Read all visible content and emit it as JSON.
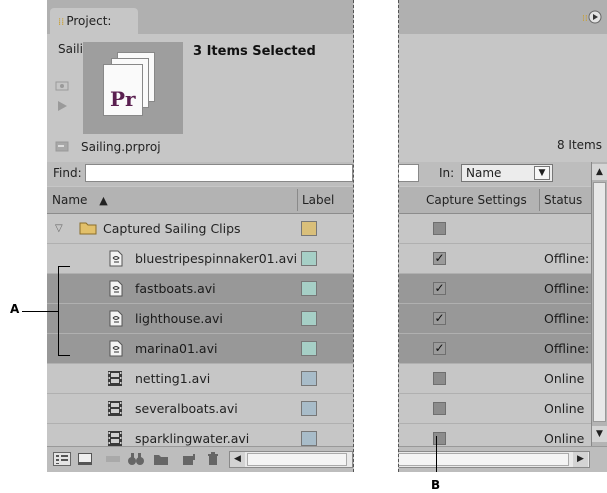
{
  "left_panel": {
    "tab_title": "Project: Sailing",
    "tab_close": "×",
    "selected_title": "3 Items Selected",
    "thumbnail_text": "Pr",
    "project_file": "Sailing.prproj",
    "find_label": "Find:",
    "columns": {
      "name": "Name",
      "label": "Label"
    },
    "rows": [
      {
        "name": "Captured Sailing Clips",
        "kind": "folder",
        "label_color": "#d9bf7a",
        "selected": false
      },
      {
        "name": "bluestripespinnaker01.avi",
        "kind": "file",
        "label_color": "#a6cfc6",
        "selected": false
      },
      {
        "name": "fastboats.avi",
        "kind": "file",
        "label_color": "#a6cfc6",
        "selected": true
      },
      {
        "name": "lighthouse.avi",
        "kind": "file",
        "label_color": "#a6cfc6",
        "selected": true
      },
      {
        "name": "marina01.avi",
        "kind": "file",
        "label_color": "#a6cfc6",
        "selected": true
      },
      {
        "name": "netting1.avi",
        "kind": "film",
        "label_color": "#a8bcc9",
        "selected": false
      },
      {
        "name": "severalboats.avi",
        "kind": "film",
        "label_color": "#a8bcc9",
        "selected": false
      },
      {
        "name": "sparklingwater.avi",
        "kind": "film",
        "label_color": "#a8bcc9",
        "selected": false
      }
    ]
  },
  "right_panel": {
    "items_count": "8 Items",
    "in_label": "In:",
    "in_value": "Name",
    "columns": {
      "capture": "Capture Settings",
      "status": "Status"
    },
    "rows": [
      {
        "checked": false,
        "status": ""
      },
      {
        "checked": true,
        "status": "Offline:"
      },
      {
        "checked": true,
        "status": "Offline:"
      },
      {
        "checked": true,
        "status": "Offline:"
      },
      {
        "checked": true,
        "status": "Offline:"
      },
      {
        "checked": false,
        "status": "Online"
      },
      {
        "checked": false,
        "status": "Online"
      },
      {
        "checked": false,
        "status": "Online"
      }
    ]
  },
  "callouts": {
    "a": "A",
    "b": "B"
  }
}
